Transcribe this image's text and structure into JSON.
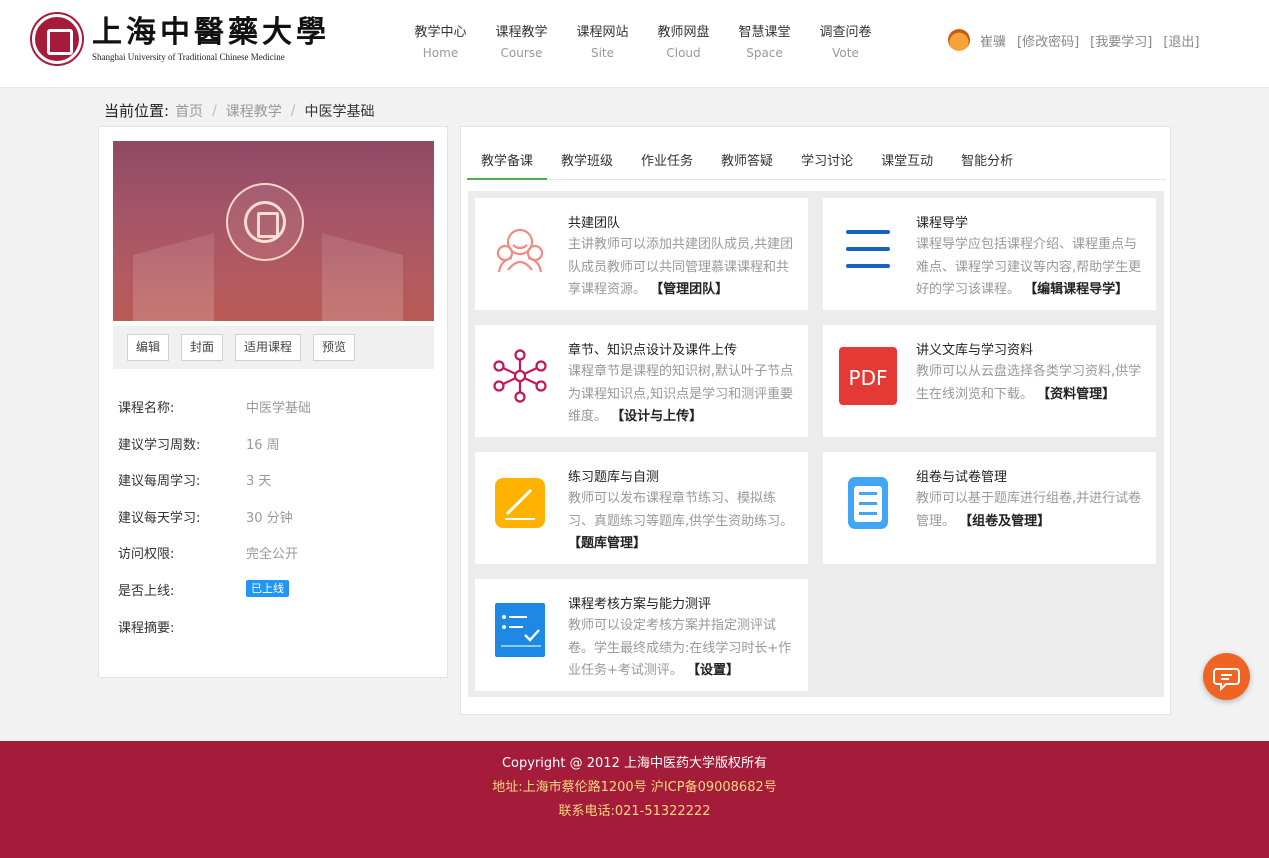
{
  "header": {
    "logo": {
      "title_cn": "上海中醫藥大學",
      "title_en": "Shanghai University of Traditional Chinese Medicine"
    },
    "nav": [
      {
        "cn": "教学中心",
        "en": "Home"
      },
      {
        "cn": "课程教学",
        "en": "Course"
      },
      {
        "cn": "课程网站",
        "en": "Site"
      },
      {
        "cn": "教师网盘",
        "en": "Cloud"
      },
      {
        "cn": "智慧课堂",
        "en": "Space"
      },
      {
        "cn": "调查问卷",
        "en": "Vote"
      }
    ],
    "user": {
      "name": "崔骥",
      "links": [
        "[修改密码]",
        "[我要学习]",
        "[退出]"
      ]
    }
  },
  "breadcrumb": {
    "label": "当前位置:",
    "items": [
      "首页",
      "课程教学"
    ],
    "current": "中医学基础"
  },
  "course": {
    "buttons": [
      "编辑",
      "封面",
      "适用课程",
      "预览"
    ],
    "info": [
      {
        "key": "课程名称:",
        "value": "中医学基础"
      },
      {
        "key": "建议学习周数:",
        "value": "16 周"
      },
      {
        "key": "建议每周学习:",
        "value": "3 天"
      },
      {
        "key": "建议每天学习:",
        "value": "30 分钟"
      },
      {
        "key": "访问权限:",
        "value": "完全公开"
      },
      {
        "key": "是否上线:",
        "badge": "已上线"
      },
      {
        "key": "课程摘要:",
        "value": ""
      }
    ]
  },
  "tabs": [
    "教学备课",
    "教学班级",
    "作业任务",
    "教师答疑",
    "学习讨论",
    "课堂互动",
    "智能分析"
  ],
  "features": [
    {
      "title": "共建团队",
      "desc": "主讲教师可以添加共建团队成员,共建团队成员教师可以共同管理慕课课程和共享课程资源。",
      "link": "【管理团队】",
      "icon": "team-icon"
    },
    {
      "title": "课程导学",
      "desc": "课程导学应包括课程介绍、课程重点与难点、课程学习建议等内容,帮助学生更好的学习该课程。",
      "link": "【编辑课程导学】",
      "icon": "menu-lines-icon"
    },
    {
      "title": "章节、知识点设计及课件上传",
      "desc": "课程章节是课程的知识树,默认叶子节点为课程知识点,知识点是学习和测评重要维度。",
      "link": "【设计与上传】",
      "icon": "knowledge-tree-icon"
    },
    {
      "title": "讲义文库与学习资料",
      "desc": "教师可以从云盘选择各类学习资料,供学生在线浏览和下载。",
      "link": "【资料管理】",
      "icon": "pdf-icon",
      "icon_text": "PDF"
    },
    {
      "title": "练习题库与自测",
      "desc": "教师可以发布课程章节练习、模拟练习、真题练习等题库,供学生资助练习。",
      "link": "【题库管理】",
      "icon": "pencil-note-icon"
    },
    {
      "title": "组卷与试卷管理",
      "desc": "教师可以基于题库进行组卷,并进行试卷管理。",
      "link": "【组卷及管理】",
      "icon": "paper-list-icon"
    },
    {
      "title": "课程考核方案与能力测评",
      "desc": "教师可以设定考核方案并指定测评试卷。学生最终成绩为:在线学习时长+作业任务+考试测评。",
      "link": "【设置】",
      "icon": "checklist-icon"
    }
  ],
  "footer": {
    "copyright": "Copyright @ 2012 上海中医药大学版权所有",
    "address": "地址:上海市蔡伦路1200号 沪ICP备09008682号",
    "phone": "联系电话:021-51322222"
  },
  "colors": {
    "brand": "#a51c3a",
    "accent_tab": "#4caf50",
    "badge": "#2196f3",
    "chat": "#f06423"
  }
}
